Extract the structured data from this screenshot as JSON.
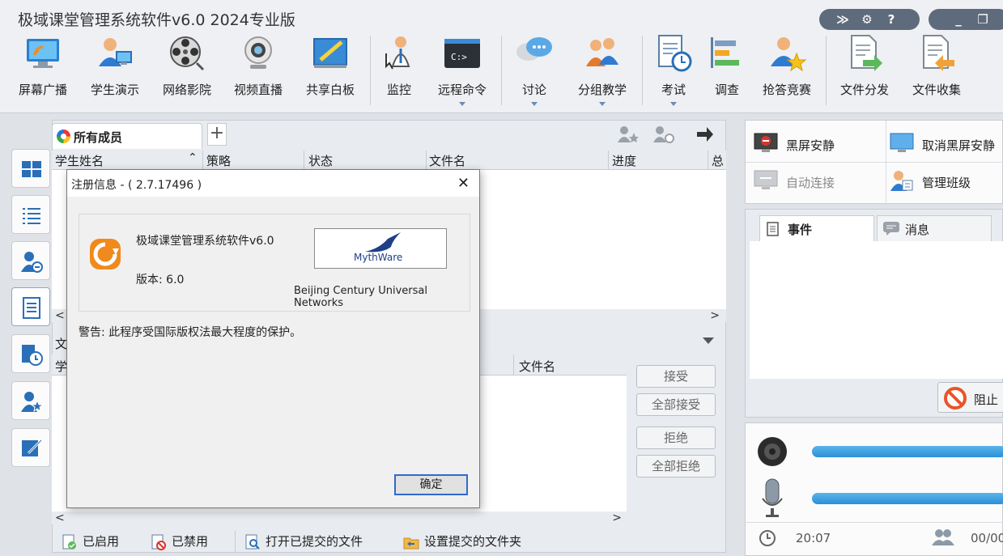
{
  "window": {
    "title": "极域课堂管理系统软件v6.0 2024专业版"
  },
  "toolbar": {
    "items": [
      {
        "label": "屏幕广播",
        "icon": "screen-broadcast-icon"
      },
      {
        "label": "学生演示",
        "icon": "student-demo-icon"
      },
      {
        "label": "网络影院",
        "icon": "film-reel-icon"
      },
      {
        "label": "视频直播",
        "icon": "webcam-icon"
      },
      {
        "label": "共享白板",
        "icon": "whiteboard-icon"
      },
      {
        "label": "监控",
        "icon": "monitor-person-icon"
      },
      {
        "label": "远程命令",
        "icon": "terminal-icon"
      },
      {
        "label": "讨论",
        "icon": "chat-bubbles-icon"
      },
      {
        "label": "分组教学",
        "icon": "group-users-icon"
      },
      {
        "label": "考试",
        "icon": "exam-clock-icon"
      },
      {
        "label": "调查",
        "icon": "survey-bars-icon"
      },
      {
        "label": "抢答竞赛",
        "icon": "star-user-icon"
      },
      {
        "label": "文件分发",
        "icon": "file-send-icon"
      },
      {
        "label": "文件收集",
        "icon": "file-collect-icon"
      }
    ]
  },
  "members_tab": {
    "label": "所有成员"
  },
  "grid": {
    "columns": [
      "学生姓名",
      "策略",
      "状态",
      "文件名",
      "进度",
      "总"
    ]
  },
  "bottom_grid": {
    "section_label": "文",
    "col_student": "学",
    "col_filename": "文件名"
  },
  "side_buttons": {
    "accept": "接受",
    "accept_all": "全部接受",
    "reject": "拒绝",
    "reject_all": "全部拒绝"
  },
  "bottom_bar": {
    "enabled": "已启用",
    "disabled": "已禁用",
    "open_submitted": "打开已提交的文件",
    "set_folder": "设置提交的文件夹"
  },
  "right_panel": {
    "black_screen": "黑屏安静",
    "cancel_black_screen": "取消黑屏安静",
    "auto_connect": "自动连接",
    "manage_class": "管理班级",
    "tab_events": "事件",
    "tab_messages": "消息",
    "block": "阻止",
    "time": "20:07",
    "count": "00/00"
  },
  "dialog": {
    "title": "注册信息 - ( 2.7.17496 )",
    "product": "极域课堂管理系统软件v6.0",
    "version": "版本: 6.0",
    "logo_text": "MythWare",
    "company": "Beijing Century Universal Networks",
    "warning": "警告: 此程序受国际版权法最大程度的保护。",
    "ok": "确定"
  }
}
